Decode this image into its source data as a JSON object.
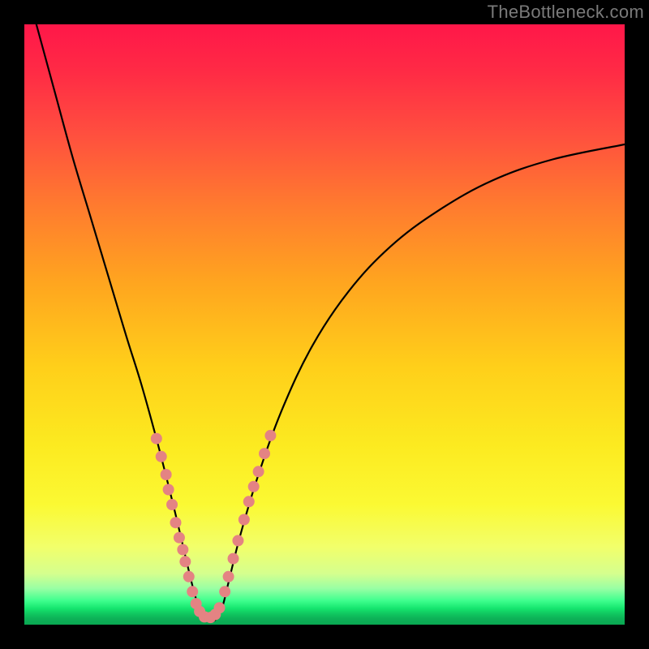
{
  "watermark": "TheBottleneck.com",
  "chart_data": {
    "type": "line",
    "title": "",
    "xlabel": "",
    "ylabel": "",
    "xlim": [
      0,
      100
    ],
    "ylim": [
      0,
      100
    ],
    "grid": false,
    "series": [
      {
        "name": "bottleneck-curve",
        "x": [
          2,
          5,
          8,
          11,
          14,
          17,
          19.5,
          22,
          23.8,
          25.4,
          26.8,
          28,
          29,
          30,
          31,
          32,
          33,
          34,
          36,
          39,
          43,
          48,
          54,
          61,
          69,
          78,
          88,
          100
        ],
        "y": [
          100,
          89,
          78,
          68,
          58,
          48,
          40,
          31,
          24,
          17.5,
          11.5,
          6.5,
          3,
          1,
          0.5,
          1,
          3,
          7,
          15,
          25,
          36,
          46.5,
          55.5,
          63,
          69,
          74,
          77.5,
          80
        ]
      }
    ],
    "markers": {
      "name": "highlighted-points",
      "color": "#e48383",
      "radius_px": 7,
      "points": [
        {
          "x": 22.0,
          "y": 31.0
        },
        {
          "x": 22.8,
          "y": 28.0
        },
        {
          "x": 23.6,
          "y": 25.0
        },
        {
          "x": 24.0,
          "y": 22.5
        },
        {
          "x": 24.6,
          "y": 20.0
        },
        {
          "x": 25.2,
          "y": 17.0
        },
        {
          "x": 25.8,
          "y": 14.5
        },
        {
          "x": 26.4,
          "y": 12.5
        },
        {
          "x": 26.8,
          "y": 10.5
        },
        {
          "x": 27.4,
          "y": 8.0
        },
        {
          "x": 28.0,
          "y": 5.5
        },
        {
          "x": 28.6,
          "y": 3.5
        },
        {
          "x": 29.2,
          "y": 2.2
        },
        {
          "x": 30.0,
          "y": 1.3
        },
        {
          "x": 31.0,
          "y": 1.2
        },
        {
          "x": 31.8,
          "y": 1.7
        },
        {
          "x": 32.5,
          "y": 2.8
        },
        {
          "x": 33.4,
          "y": 5.5
        },
        {
          "x": 34.0,
          "y": 8.0
        },
        {
          "x": 34.8,
          "y": 11.0
        },
        {
          "x": 35.6,
          "y": 14.0
        },
        {
          "x": 36.6,
          "y": 17.5
        },
        {
          "x": 37.4,
          "y": 20.5
        },
        {
          "x": 38.2,
          "y": 23.0
        },
        {
          "x": 39.0,
          "y": 25.5
        },
        {
          "x": 40.0,
          "y": 28.5
        },
        {
          "x": 41.0,
          "y": 31.5
        }
      ]
    },
    "background_gradient": {
      "orientation": "vertical",
      "stops": [
        {
          "pos": 0.0,
          "color": "#ff1749"
        },
        {
          "pos": 0.3,
          "color": "#ff7a2f"
        },
        {
          "pos": 0.57,
          "color": "#ffcf1a"
        },
        {
          "pos": 0.8,
          "color": "#fbf933"
        },
        {
          "pos": 0.94,
          "color": "#98ffa4"
        },
        {
          "pos": 1.0,
          "color": "#0aa852"
        }
      ]
    }
  }
}
